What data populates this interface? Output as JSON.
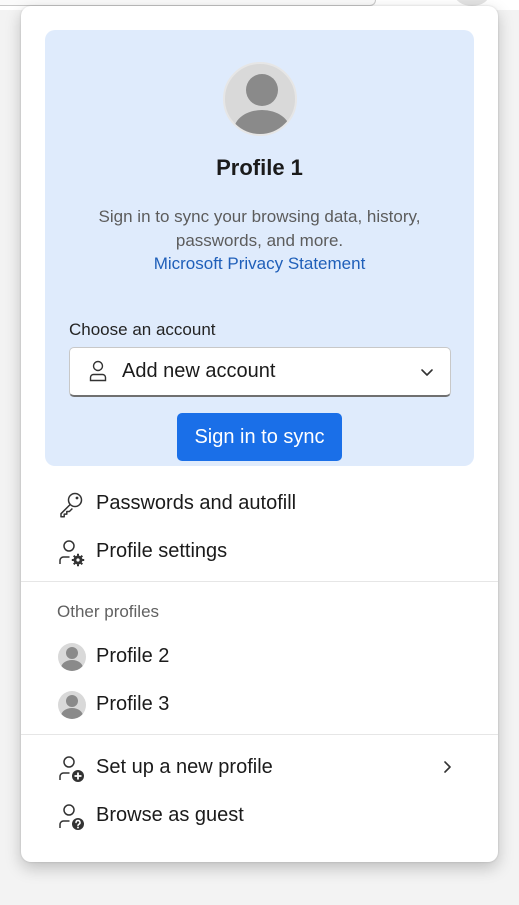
{
  "profile_card": {
    "name": "Profile 1",
    "description": "Sign in to sync your browsing data, history, passwords, and more.",
    "privacy_link": "Microsoft Privacy Statement",
    "choose_label": "Choose an account",
    "account_select_value": "Add new account",
    "sync_button": "Sign in to sync"
  },
  "menu": {
    "passwords": "Passwords and autofill",
    "profile_settings": "Profile settings"
  },
  "other_profiles": {
    "label": "Other profiles",
    "items": [
      {
        "label": "Profile 2"
      },
      {
        "label": "Profile 3"
      }
    ]
  },
  "bottom_menu": {
    "new_profile": "Set up a new profile",
    "guest": "Browse as guest"
  },
  "colors": {
    "card_bg": "#dfebfc",
    "accent": "#1a6fe8",
    "link": "#1f5fb9"
  },
  "icons": {
    "avatar": "avatar-icon",
    "person": "person-icon",
    "key": "key-icon",
    "profile_settings": "profile-settings-icon",
    "add_profile": "add-profile-icon",
    "guest": "guest-icon",
    "chevron_down": "chevron-down-icon",
    "chevron_right": "chevron-right-icon"
  }
}
